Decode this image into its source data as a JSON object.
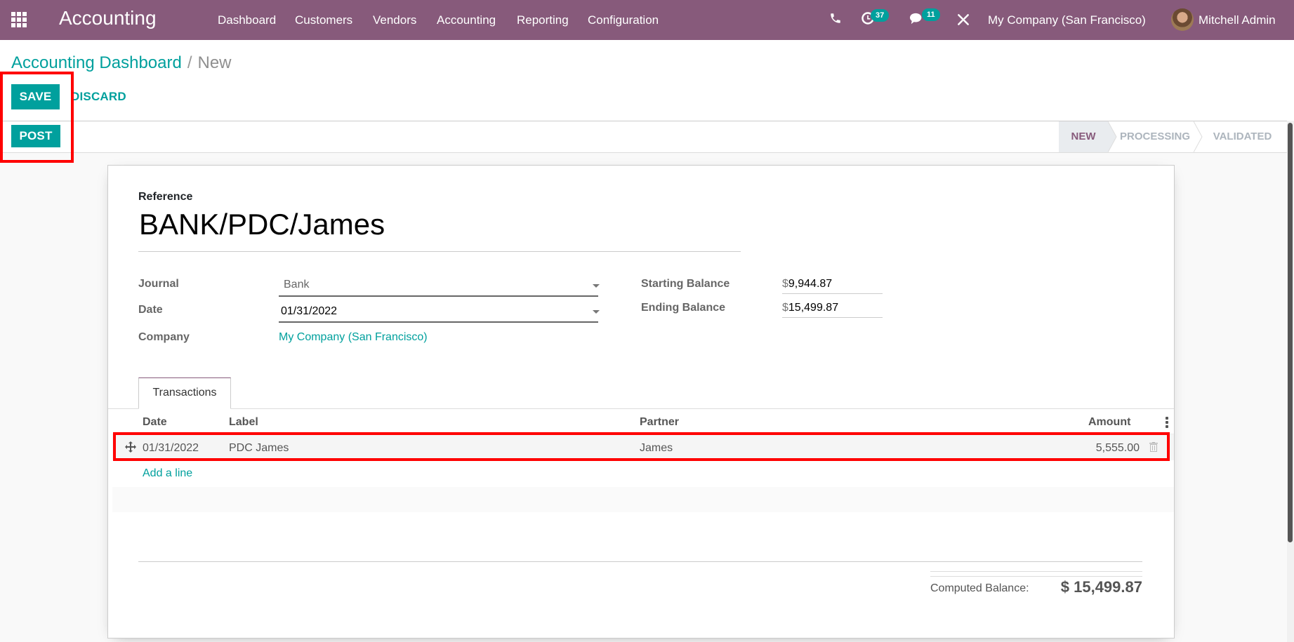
{
  "navbar": {
    "app_title": "Accounting",
    "menu": [
      "Dashboard",
      "Customers",
      "Vendors",
      "Accounting",
      "Reporting",
      "Configuration"
    ],
    "activity_count": "37",
    "message_count": "11",
    "company": "My Company (San Francisco)",
    "user": "Mitchell Admin",
    "bg_color": "#875a7b"
  },
  "breadcrumb": {
    "parent": "Accounting Dashboard",
    "separator": "/",
    "current": "New"
  },
  "buttons": {
    "save": "SAVE",
    "discard": "DISCARD",
    "post": "POST"
  },
  "statusbar": {
    "stages": [
      "NEW",
      "PROCESSING",
      "VALIDATED"
    ],
    "active": "NEW"
  },
  "form": {
    "reference_label": "Reference",
    "reference_value": "BANK/PDC/James",
    "journal_label": "Journal",
    "journal_value": "Bank",
    "date_label": "Date",
    "date_value": "01/31/2022",
    "company_label": "Company",
    "company_value": "My Company (San Francisco)",
    "starting_balance_label": "Starting Balance",
    "starting_balance_currency": "$",
    "starting_balance_value": "9,944.87",
    "ending_balance_label": "Ending Balance",
    "ending_balance_currency": "$",
    "ending_balance_value": "15,499.87"
  },
  "notebook": {
    "tabs": [
      "Transactions"
    ],
    "columns": [
      "Date",
      "Label",
      "Partner",
      "Amount"
    ],
    "rows": [
      {
        "date": "01/31/2022",
        "label": "PDC James",
        "partner": "James",
        "amount": "5,555.00"
      }
    ],
    "add_line": "Add a line"
  },
  "totals": {
    "computed_balance_label": "Computed Balance:",
    "computed_balance_value": "$ 15,499.87"
  },
  "colors": {
    "accent": "#00a09d",
    "brand": "#875a7b",
    "highlight": "#ff0000"
  }
}
